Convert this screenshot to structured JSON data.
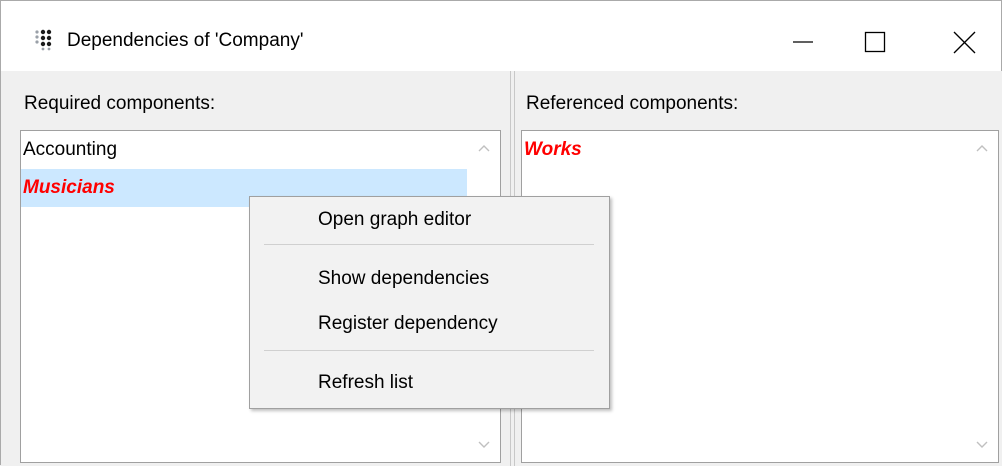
{
  "window": {
    "title": "Dependencies of 'Company'",
    "icon": "dots-grid-icon",
    "controls": {
      "minimize": "minimize-icon",
      "maximize": "maximize-icon",
      "close": "close-icon"
    }
  },
  "required": {
    "label": "Required components:",
    "items": [
      {
        "text": "Accounting",
        "missing": false,
        "selected": false
      },
      {
        "text": "Musicians",
        "missing": true,
        "selected": true
      }
    ]
  },
  "referenced": {
    "label": "Referenced components:",
    "items": [
      {
        "text": "Works",
        "missing": true,
        "selected": false
      }
    ]
  },
  "context_menu": {
    "items": [
      "Open graph editor",
      "Show dependencies",
      "Register dependency",
      "Refresh list"
    ]
  },
  "colors": {
    "missing_text": "#ff0000",
    "selection": "#cce8ff",
    "window_bg": "#f0f0f0"
  }
}
